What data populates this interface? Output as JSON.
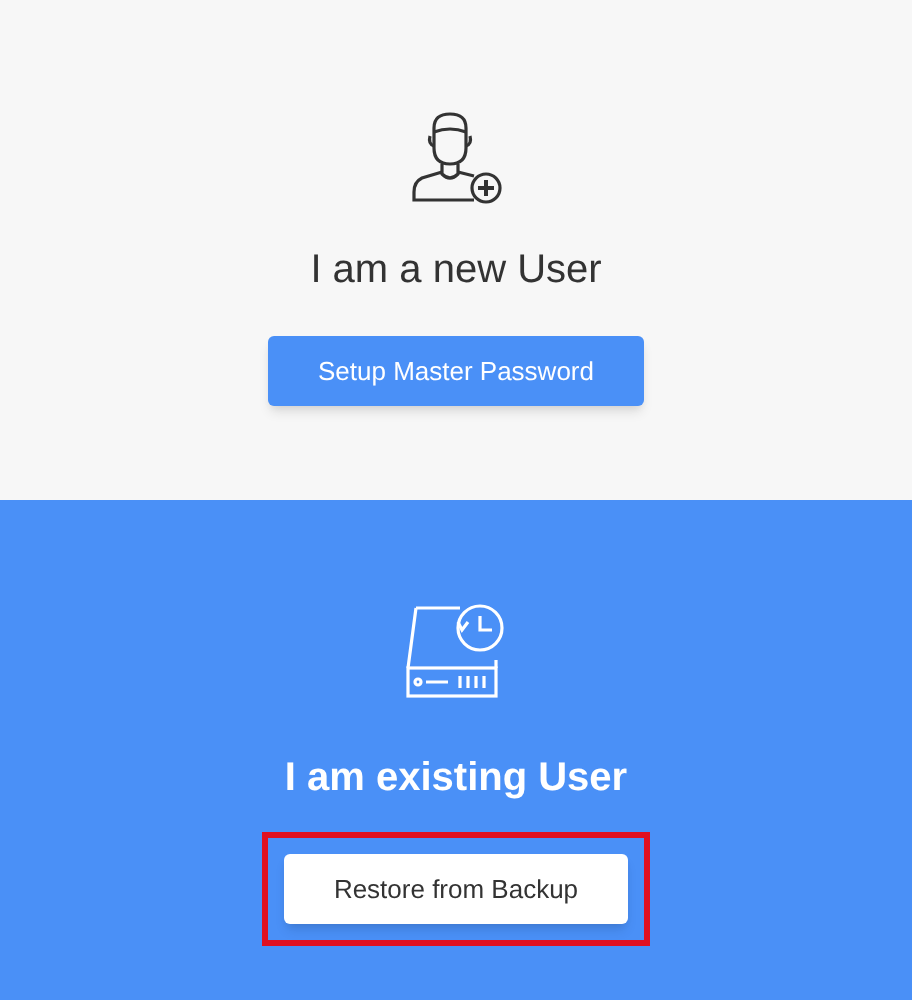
{
  "new_user": {
    "title": "I am a new User",
    "button": "Setup Master Password"
  },
  "existing_user": {
    "title": "I am existing User",
    "button": "Restore from Backup",
    "highlighted": true
  }
}
